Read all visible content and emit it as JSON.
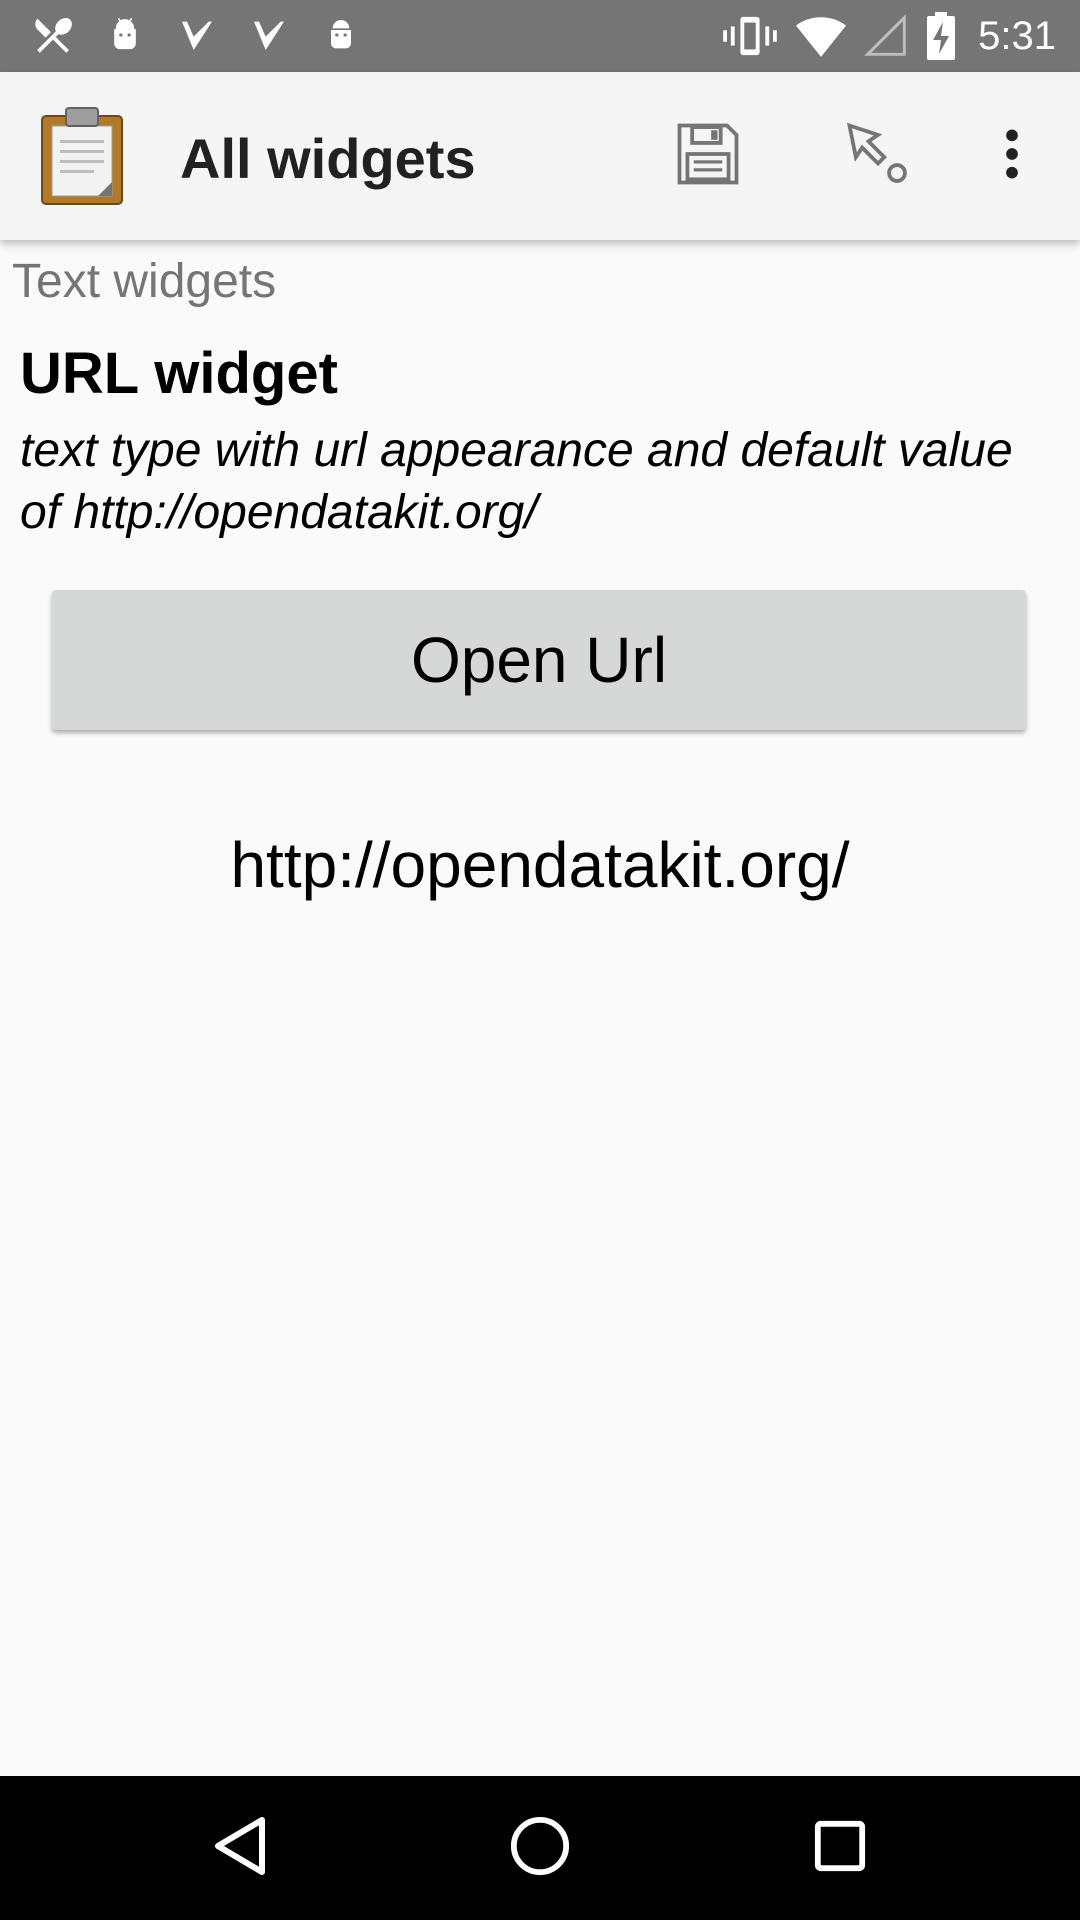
{
  "status_bar": {
    "time": "5:31",
    "left_icons": [
      "restaurant-icon",
      "android-icon",
      "check-icon",
      "check-icon",
      "android-icon"
    ],
    "right_icons": [
      "vibrate-icon",
      "wifi-icon",
      "signal-icon",
      "battery-charging-icon"
    ]
  },
  "toolbar": {
    "title": "All widgets",
    "icons": [
      "clipboard-app-icon",
      "save-icon",
      "jump-icon",
      "overflow-menu-icon"
    ]
  },
  "form": {
    "group_label": "Text widgets",
    "question_title": "URL widget",
    "question_hint": "text type with url appearance and default value of http://opendatakit.org/",
    "button_label": "Open Url",
    "url_value": "http://opendatakit.org/"
  },
  "nav_bar": {
    "icons": [
      "back-icon",
      "home-icon",
      "recents-icon"
    ]
  },
  "colors": {
    "status_bar": "#757575",
    "toolbar": "#f5f5f5",
    "background": "#fafafa",
    "button": "#d6d7d7",
    "nav_bar": "#000000"
  }
}
